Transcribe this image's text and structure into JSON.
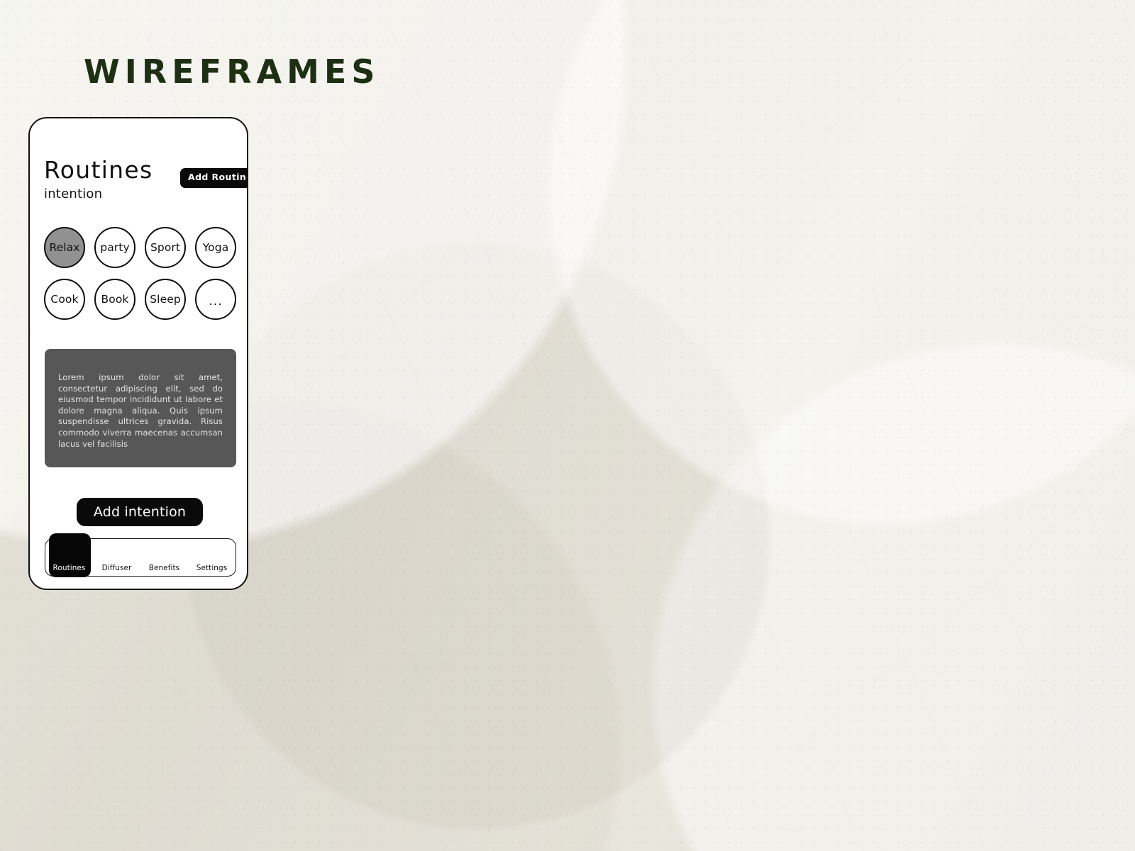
{
  "page": {
    "title": "WIREFRAMES",
    "title_color": "#1e3014",
    "background_color": "#e7e4dc"
  },
  "phone": {
    "header": {
      "title": "Routines",
      "add_routine_label": "Add Routine",
      "subtitle": "intention"
    },
    "chips": [
      {
        "label": "Relax",
        "selected": true
      },
      {
        "label": "party",
        "selected": false
      },
      {
        "label": "Sport",
        "selected": false
      },
      {
        "label": "Yoga",
        "selected": false
      },
      {
        "label": "Cook",
        "selected": false
      },
      {
        "label": "Book",
        "selected": false
      },
      {
        "label": "Sleep",
        "selected": false
      },
      {
        "label": "...",
        "selected": false
      }
    ],
    "description": {
      "text": "Lorem ipsum dolor sit amet, consectetur adipiscing elit, sed do eiusmod tempor incididunt ut labore et dolore magna aliqua. Quis ipsum suspendisse ultrices gravida. Risus commodo viverra maecenas accumsan lacus vel facilisis",
      "background_color": "#575757",
      "text_color": "#e3e3e3"
    },
    "primary_action": {
      "label": "Add intention"
    },
    "bottom_nav": {
      "items": [
        {
          "label": "Routines",
          "active": true
        },
        {
          "label": "Diffuser",
          "active": false
        },
        {
          "label": "Benefits",
          "active": false
        },
        {
          "label": "Settings",
          "active": false
        }
      ]
    }
  }
}
